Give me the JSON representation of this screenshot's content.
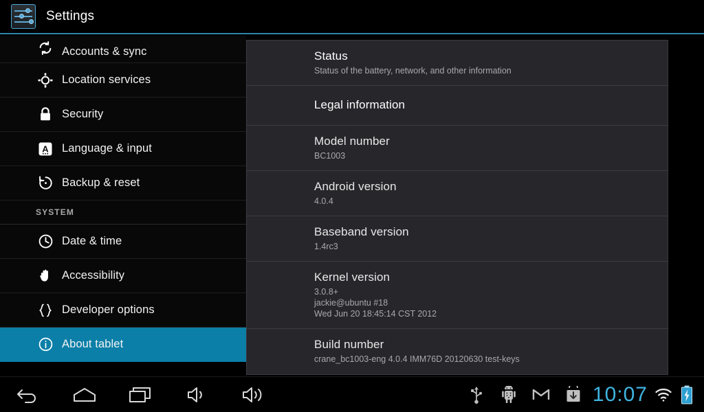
{
  "titlebar": {
    "app_name": "Settings",
    "icon": "settings-sliders-icon",
    "accent_color": "#2e86ab"
  },
  "sidebar": {
    "selected_color": "#0b7fa8",
    "items": [
      {
        "label": "Accounts & sync",
        "icon": "sync-icon",
        "selected": false,
        "partial": true
      },
      {
        "label": "Location services",
        "icon": "location-icon",
        "selected": false
      },
      {
        "label": "Security",
        "icon": "lock-icon",
        "selected": false
      },
      {
        "label": "Language & input",
        "icon": "keyboard-a-icon",
        "selected": false
      },
      {
        "label": "Backup & reset",
        "icon": "backup-reset-icon",
        "selected": false
      }
    ],
    "section_label": "SYSTEM",
    "system_items": [
      {
        "label": "Date & time",
        "icon": "clock-icon",
        "selected": false
      },
      {
        "label": "Accessibility",
        "icon": "hand-icon",
        "selected": false
      },
      {
        "label": "Developer options",
        "icon": "braces-icon",
        "selected": false
      },
      {
        "label": "About tablet",
        "icon": "info-circle-icon",
        "selected": true
      }
    ]
  },
  "content": {
    "rows": [
      {
        "title": "Status",
        "value": "Status of the battery, network, and other information"
      },
      {
        "title": "Legal information",
        "value": ""
      },
      {
        "title": "Model number",
        "value": "BC1003"
      },
      {
        "title": "Android version",
        "value": "4.0.4"
      },
      {
        "title": "Baseband version",
        "value": "1.4rc3"
      },
      {
        "title": "Kernel version",
        "value": "3.0.8+\njackie@ubuntu #18\nWed Jun 20 18:45:14 CST 2012"
      },
      {
        "title": "Build number",
        "value": "crane_bc1003-eng 4.0.4 IMM76D 20120630 test-keys"
      }
    ]
  },
  "navbar": {
    "buttons": [
      {
        "name": "back-button",
        "icon": "back-arrow-icon"
      },
      {
        "name": "home-button",
        "icon": "home-icon"
      },
      {
        "name": "recents-button",
        "icon": "recents-icon"
      },
      {
        "name": "volume-down-button",
        "icon": "volume-down-icon"
      },
      {
        "name": "volume-up-button",
        "icon": "volume-up-icon"
      }
    ],
    "status_icons": [
      {
        "name": "usb-icon"
      },
      {
        "name": "android-debug-icon"
      },
      {
        "name": "gmail-icon"
      },
      {
        "name": "download-icon"
      }
    ],
    "clock": "10:07",
    "clock_color": "#3fb4e0",
    "wifi": "wifi-icon",
    "battery": "battery-charging-icon"
  }
}
